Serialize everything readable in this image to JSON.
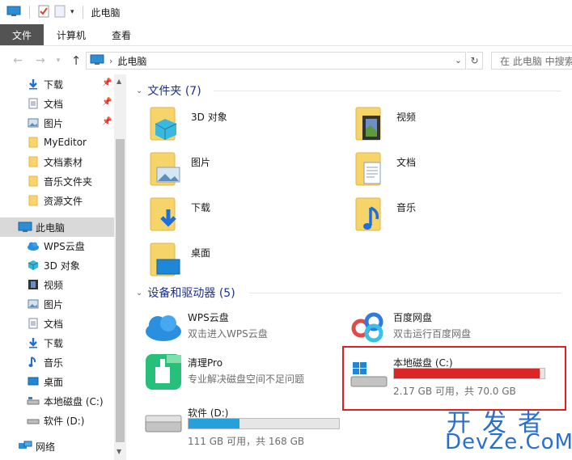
{
  "window": {
    "title": "此电脑"
  },
  "ribbon": {
    "tabs": [
      "文件",
      "计算机",
      "查看"
    ]
  },
  "address": {
    "location": "此电脑",
    "search_placeholder": "在 此电脑 中搜索"
  },
  "sidebar": {
    "quick_access": [
      {
        "label": "下载",
        "icon": "download-icon",
        "pinned": true
      },
      {
        "label": "文档",
        "icon": "document-icon",
        "pinned": true
      },
      {
        "label": "图片",
        "icon": "picture-icon",
        "pinned": true
      },
      {
        "label": "MyEditor",
        "icon": "folder-icon",
        "pinned": false
      },
      {
        "label": "文档素材",
        "icon": "folder-icon",
        "pinned": false
      },
      {
        "label": "音乐文件夹",
        "icon": "folder-icon",
        "pinned": false
      },
      {
        "label": "资源文件",
        "icon": "folder-icon",
        "pinned": false
      }
    ],
    "this_pc": {
      "label": "此电脑",
      "icon": "computer-icon"
    },
    "pc_children": [
      {
        "label": "WPS云盘",
        "icon": "cloud-icon"
      },
      {
        "label": "3D 对象",
        "icon": "cube-icon"
      },
      {
        "label": "视频",
        "icon": "video-icon"
      },
      {
        "label": "图片",
        "icon": "picture-icon"
      },
      {
        "label": "文档",
        "icon": "document-icon"
      },
      {
        "label": "下载",
        "icon": "download-icon"
      },
      {
        "label": "音乐",
        "icon": "music-icon"
      },
      {
        "label": "桌面",
        "icon": "desktop-icon"
      },
      {
        "label": "本地磁盘 (C:)",
        "icon": "drive-icon"
      },
      {
        "label": "软件 (D:)",
        "icon": "drive-icon"
      }
    ],
    "network": {
      "label": "网络",
      "icon": "network-icon"
    }
  },
  "folders_group": {
    "header": "文件夹 (7)",
    "items": [
      {
        "label": "3D 对象",
        "icon": "cube-folder-icon"
      },
      {
        "label": "视频",
        "icon": "video-folder-icon"
      },
      {
        "label": "图片",
        "icon": "picture-folder-icon"
      },
      {
        "label": "文档",
        "icon": "document-folder-icon"
      },
      {
        "label": "下载",
        "icon": "download-folder-icon"
      },
      {
        "label": "音乐",
        "icon": "music-folder-icon"
      },
      {
        "label": "桌面",
        "icon": "desktop-folder-icon"
      }
    ]
  },
  "devices_group": {
    "header": "设备和驱动器 (5)",
    "items": [
      {
        "name": "WPS云盘",
        "sub": "双击进入WPS云盘",
        "icon": "wps-cloud-icon"
      },
      {
        "name": "百度网盘",
        "sub": "双击运行百度网盘",
        "icon": "baidu-netdisk-icon"
      },
      {
        "name": "清理Pro",
        "sub": "专业解决磁盘空间不足问题",
        "icon": "cleaner-pro-icon"
      },
      {
        "name": "本地磁盘 (C:)",
        "info": "2.17 GB 可用，共 70.0 GB",
        "used_fraction": 0.969,
        "bar_color": "#da2626",
        "icon": "windows-drive-icon"
      },
      {
        "name": "软件 (D:)",
        "info": "111 GB 可用，共 168 GB",
        "used_fraction": 0.339,
        "bar_color": "#26a0da",
        "icon": "drive-icon"
      }
    ]
  },
  "watermark": {
    "cn": "开发者",
    "en": "DevZe.CoM"
  },
  "colors": {
    "accent": "#1e3287",
    "highlight_box": "#e02020",
    "watermark": "#2a6fc9"
  }
}
